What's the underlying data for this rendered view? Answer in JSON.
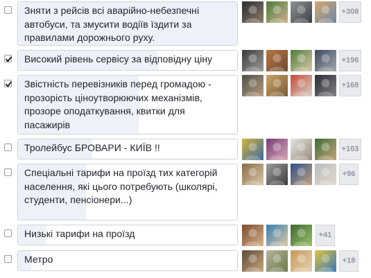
{
  "poll": {
    "options": [
      {
        "label": "Зняти з рейсів всі аварійно-небезпечні автобуси, та змусити водіїв їздити за правилами дорожнього руху.",
        "checked": false,
        "more_voters": "+308",
        "fill_fraction": 1.0,
        "avatars": [
          {
            "name": "voter-avatar",
            "c1": "#2a2d33",
            "c2": "#8d7b66"
          },
          {
            "name": "voter-avatar",
            "c1": "#4d7a3a",
            "c2": "#c9b18c"
          },
          {
            "name": "voter-avatar",
            "c1": "#8f9296",
            "c2": "#3c3f44"
          },
          {
            "name": "voter-avatar",
            "c1": "#d4a76a",
            "c2": "#6f87a8"
          }
        ]
      },
      {
        "label": "Високий рівень сервісу за відповідну ціну",
        "checked": true,
        "more_voters": "+196",
        "fill_fraction": 0.64,
        "avatars": [
          {
            "name": "voter-avatar",
            "c1": "#3a3a3a",
            "c2": "#9c9c9c"
          },
          {
            "name": "voter-avatar",
            "c1": "#b8763f",
            "c2": "#6e4b33"
          },
          {
            "name": "voter-avatar",
            "c1": "#4f7d3b",
            "c2": "#d7c7a8"
          },
          {
            "name": "voter-avatar",
            "c1": "#3d4a5c",
            "c2": "#a3a8b0"
          }
        ]
      },
      {
        "label": "Звістність перевізників перед громадою - прозорість ціноутворюючих механізмів, прозоре оподаткування, квитки для пасажирів",
        "checked": true,
        "more_voters": "+168",
        "fill_fraction": 0.55,
        "avatars": [
          {
            "name": "voter-avatar",
            "c1": "#4e4f4a",
            "c2": "#b59a7d"
          },
          {
            "name": "voter-avatar",
            "c1": "#c8a267",
            "c2": "#7a5c3a"
          },
          {
            "name": "voter-avatar",
            "c1": "#c24a3a",
            "c2": "#d9d2c6"
          },
          {
            "name": "voter-avatar",
            "c1": "#2c2e33",
            "c2": "#7e8087"
          }
        ]
      },
      {
        "label": "Тролейбус БРОВАРИ - КИЇВ !!",
        "checked": false,
        "more_voters": "+103",
        "fill_fraction": 0.34,
        "avatars": [
          {
            "name": "voter-avatar",
            "c1": "#d1b23e",
            "c2": "#3d6aa0"
          },
          {
            "name": "voter-avatar",
            "c1": "#7a3f7a",
            "c2": "#d6a6b3"
          },
          {
            "name": "voter-avatar",
            "c1": "#e3e3e3",
            "c2": "#9a8b7a"
          },
          {
            "name": "voter-avatar",
            "c1": "#3e6b36",
            "c2": "#c3a77a"
          }
        ]
      },
      {
        "label": "Спеціальні тарифи на проїзд тих категорій населення, які цього потребують (школярі, студенти, пенсіонери...)",
        "checked": false,
        "more_voters": "+96",
        "fill_fraction": 0.31,
        "avatars": [
          {
            "name": "voter-avatar",
            "c1": "#8a6a47",
            "c2": "#d9c9a6"
          },
          {
            "name": "voter-avatar",
            "c1": "#9c9c9c",
            "c2": "#3b3b3b"
          },
          {
            "name": "voter-avatar",
            "c1": "#2b4f8a",
            "c2": "#c2a37c"
          },
          {
            "name": "voter-avatar",
            "c1": "#b9bcc0",
            "c2": "#e2d8c8"
          }
        ]
      },
      {
        "label": "Низькі тарифи на проїзд",
        "checked": false,
        "more_voters": "+41",
        "fill_fraction": 0.13,
        "avatars": [
          {
            "name": "voter-avatar",
            "c1": "#7a4a2e",
            "c2": "#d9b38a"
          },
          {
            "name": "voter-avatar",
            "c1": "#3b7fb3",
            "c2": "#d8c8a0"
          },
          {
            "name": "voter-avatar",
            "c1": "#3f6a2f",
            "c2": "#9cbf6a"
          }
        ]
      },
      {
        "label": "Метро",
        "checked": false,
        "more_voters": "+18",
        "fill_fraction": 0.06,
        "avatars": [
          {
            "name": "voter-avatar",
            "c1": "#5a4a3a",
            "c2": "#c9a67a"
          },
          {
            "name": "voter-avatar",
            "c1": "#b8b29a",
            "c2": "#6a7a4a"
          },
          {
            "name": "voter-avatar",
            "c1": "#c79a5a",
            "c2": "#e2d0b0"
          },
          {
            "name": "voter-avatar",
            "c1": "#e0c23a",
            "c2": "#3a7ab8"
          }
        ]
      }
    ]
  }
}
